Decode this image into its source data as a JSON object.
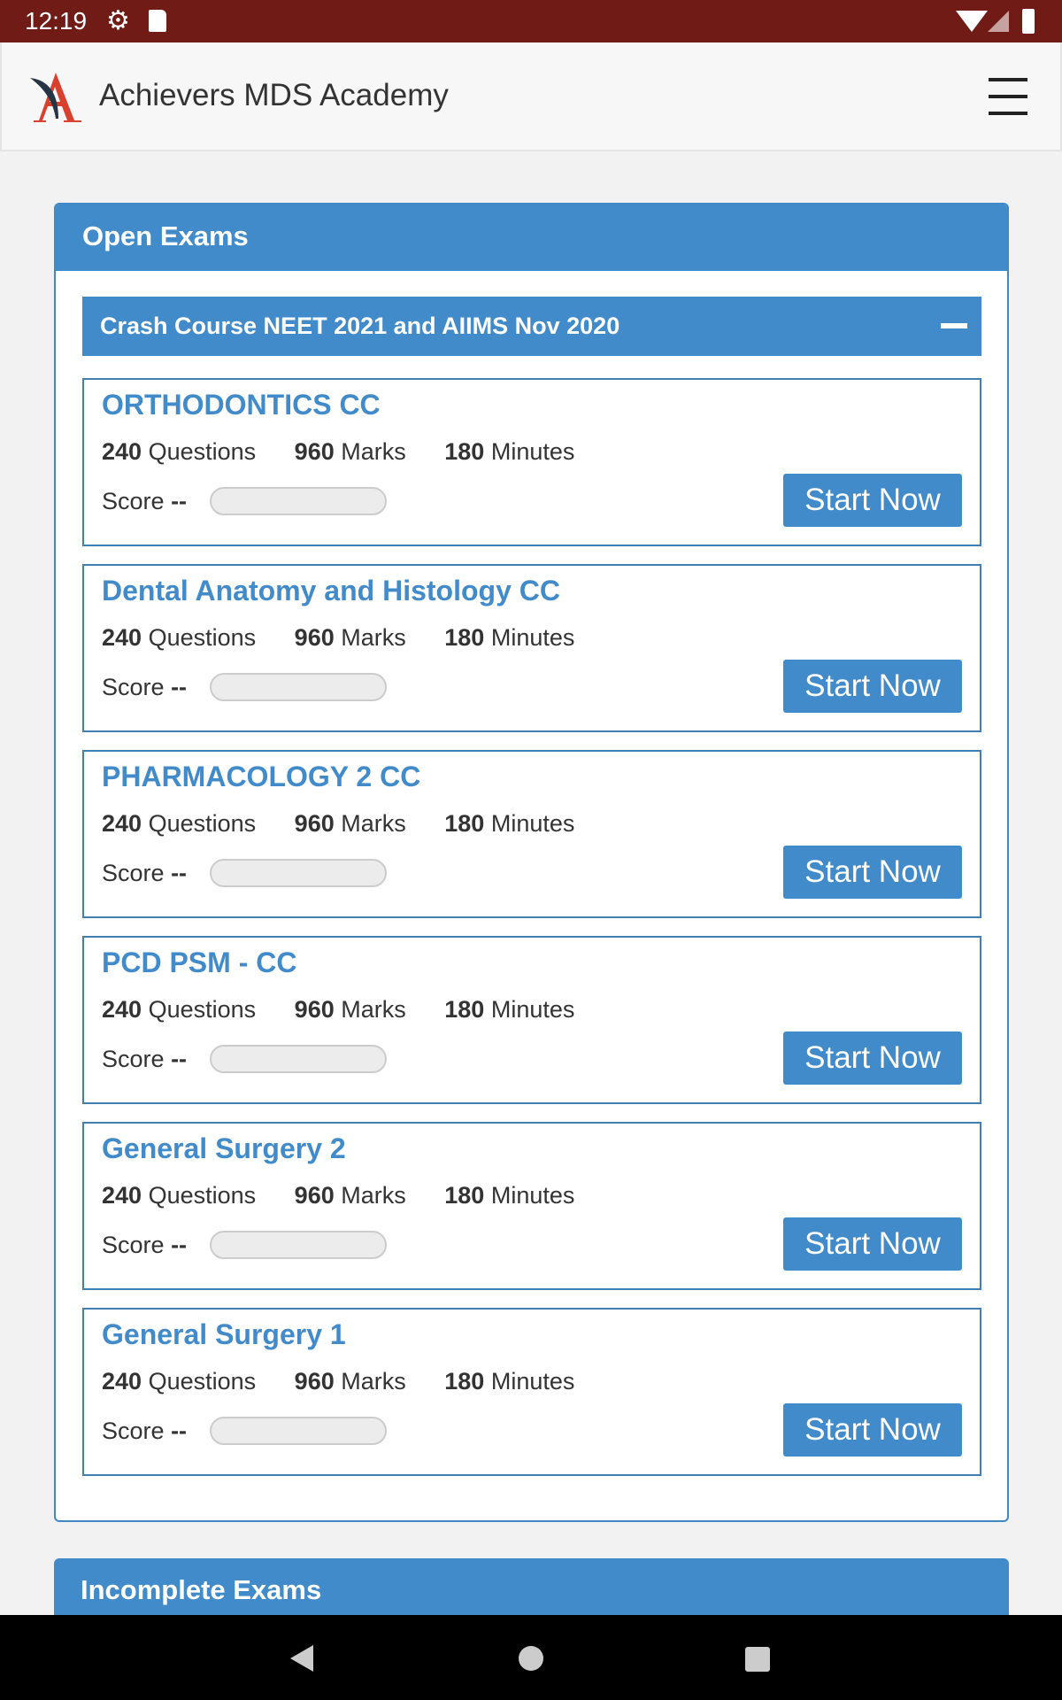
{
  "status_bar": {
    "time": "12:19"
  },
  "header": {
    "title": "Achievers MDS Academy"
  },
  "open_exams": {
    "title": "Open Exams",
    "section_title": "Crash Course NEET 2021 and AIIMS Nov 2020",
    "exams": [
      {
        "title": "ORTHODONTICS CC",
        "questions": "240",
        "questions_label": "Questions",
        "marks": "960",
        "marks_label": "Marks",
        "minutes": "180",
        "minutes_label": "Minutes",
        "score_label": "Score",
        "score": "--",
        "button": "Start Now"
      },
      {
        "title": "Dental Anatomy and Histology CC",
        "questions": "240",
        "questions_label": "Questions",
        "marks": "960",
        "marks_label": "Marks",
        "minutes": "180",
        "minutes_label": "Minutes",
        "score_label": "Score",
        "score": "--",
        "button": "Start Now"
      },
      {
        "title": "PHARMACOLOGY 2 CC",
        "questions": "240",
        "questions_label": "Questions",
        "marks": "960",
        "marks_label": "Marks",
        "minutes": "180",
        "minutes_label": "Minutes",
        "score_label": "Score",
        "score": "--",
        "button": "Start Now"
      },
      {
        "title": "PCD PSM - CC",
        "questions": "240",
        "questions_label": "Questions",
        "marks": "960",
        "marks_label": "Marks",
        "minutes": "180",
        "minutes_label": "Minutes",
        "score_label": "Score",
        "score": "--",
        "button": "Start Now"
      },
      {
        "title": "General Surgery 2",
        "questions": "240",
        "questions_label": "Questions",
        "marks": "960",
        "marks_label": "Marks",
        "minutes": "180",
        "minutes_label": "Minutes",
        "score_label": "Score",
        "score": "--",
        "button": "Start Now"
      },
      {
        "title": "General Surgery 1",
        "questions": "240",
        "questions_label": "Questions",
        "marks": "960",
        "marks_label": "Marks",
        "minutes": "180",
        "minutes_label": "Minutes",
        "score_label": "Score",
        "score": "--",
        "button": "Start Now"
      }
    ]
  },
  "incomplete_exams": {
    "title": "Incomplete Exams"
  },
  "colors": {
    "status_bar": "#701b15",
    "accent": "#428bca"
  }
}
